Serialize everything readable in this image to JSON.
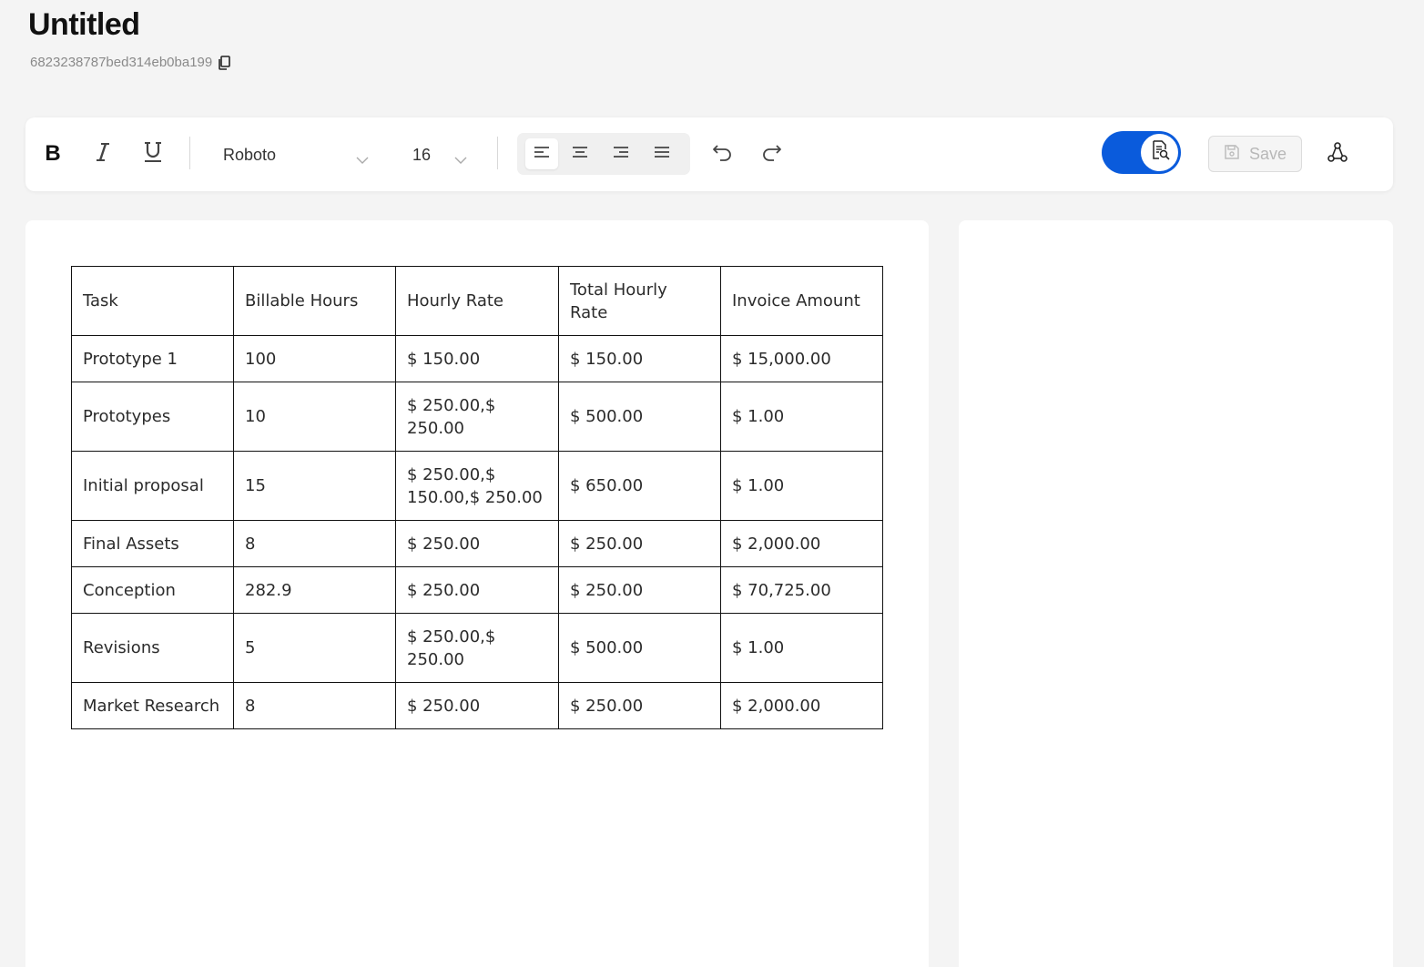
{
  "document": {
    "title": "Untitled",
    "id": "6823238787bed314eb0ba199"
  },
  "toolbar": {
    "bold_label": "B",
    "font_family": "Roboto",
    "font_size": "16",
    "alignment_active": "left",
    "preview_toggle_on": true,
    "save_label": "Save",
    "accent_color": "#0a5bdc"
  },
  "table": {
    "headers": [
      "Task",
      "Billable Hours",
      "Hourly Rate",
      "Total Hourly Rate",
      "Invoice Amount"
    ],
    "rows": [
      [
        "Prototype 1",
        "100",
        "$ 150.00",
        "$ 150.00",
        "$ 15,000.00"
      ],
      [
        "Prototypes",
        "10",
        "$ 250.00,$ 250.00",
        "$ 500.00",
        "$ 1.00"
      ],
      [
        "Initial proposal",
        "15",
        "$ 250.00,$ 150.00,$ 250.00",
        "$ 650.00",
        "$ 1.00"
      ],
      [
        "Final Assets",
        "8",
        "$ 250.00",
        "$ 250.00",
        "$ 2,000.00"
      ],
      [
        "Conception",
        "282.9",
        "$ 250.00",
        "$ 250.00",
        "$ 70,725.00"
      ],
      [
        "Revisions",
        "5",
        "$ 250.00,$ 250.00",
        "$ 500.00",
        "$ 1.00"
      ],
      [
        "Market Research",
        "8",
        "$ 250.00",
        "$ 250.00",
        "$ 2,000.00"
      ]
    ]
  }
}
